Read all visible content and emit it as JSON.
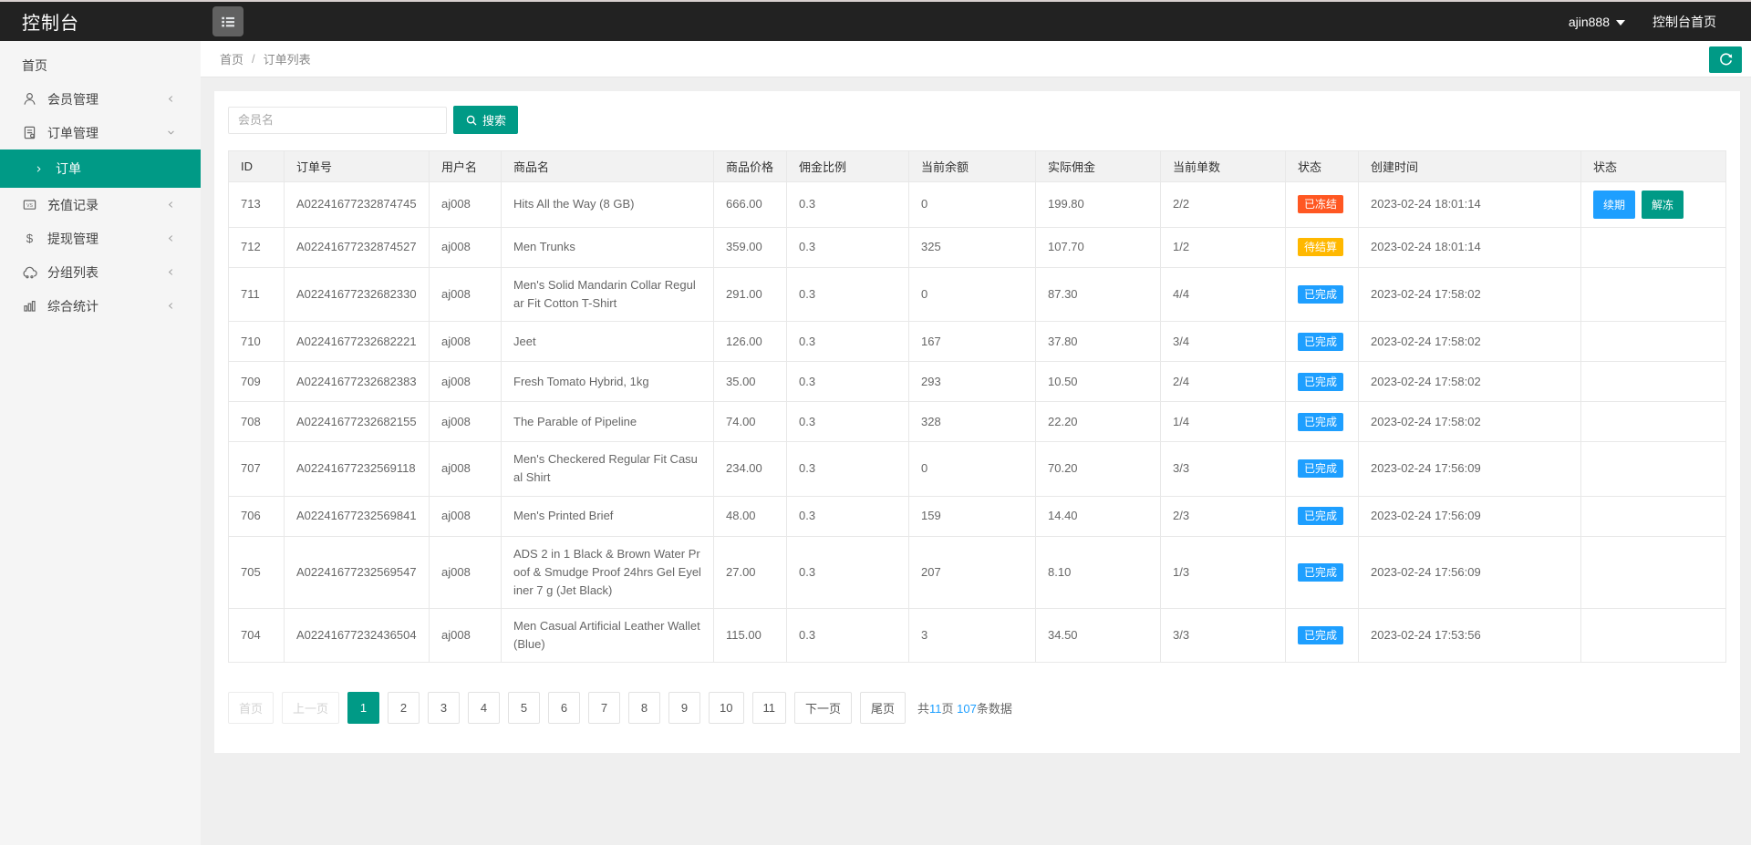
{
  "navbar": {
    "title": "控制台",
    "username": "ajin888",
    "console_home": "控制台首页"
  },
  "breadcrumb": {
    "home": "首页",
    "separator": "/",
    "current": "订单列表"
  },
  "search": {
    "placeholder": "会员名",
    "button_label": "搜索"
  },
  "sidebar": {
    "items": [
      {
        "key": "home",
        "label": "首页"
      },
      {
        "key": "members",
        "label": "会员管理",
        "icon": "user-icon",
        "chevron": "left"
      },
      {
        "key": "orders",
        "label": "订单管理",
        "icon": "order-icon",
        "chevron": "down",
        "submenu": [
          {
            "key": "order-list",
            "label": "订单",
            "active": true
          }
        ]
      },
      {
        "key": "recharge",
        "label": "充值记录",
        "icon": "card-icon",
        "chevron": "left"
      },
      {
        "key": "withdraw",
        "label": "提现管理",
        "icon": "dollar-icon",
        "chevron": "left"
      },
      {
        "key": "groups",
        "label": "分组列表",
        "icon": "group-icon",
        "chevron": "left"
      },
      {
        "key": "stats",
        "label": "综合统计",
        "icon": "chart-icon",
        "chevron": "left"
      }
    ]
  },
  "table": {
    "headers": [
      "ID",
      "订单号",
      "用户名",
      "商品名",
      "商品价格",
      "佣金比例",
      "当前余额",
      "实际佣金",
      "当前单数",
      "状态",
      "创建时间",
      "状态"
    ],
    "rows": [
      {
        "id": "713",
        "order_no": "A02241677232874745",
        "user": "aj008",
        "product": "Hits All the Way (8 GB)",
        "price": "666.00",
        "ratio": "0.3",
        "balance": "0",
        "commission": "199.80",
        "count": "2/2",
        "status": {
          "label": "已冻结",
          "type": "frozen"
        },
        "created": "2023-02-24 18:01:14",
        "actions": [
          {
            "label": "续期",
            "type": "renew"
          },
          {
            "label": "解冻",
            "type": "unfreeze"
          }
        ]
      },
      {
        "id": "712",
        "order_no": "A02241677232874527",
        "user": "aj008",
        "product": "Men Trunks",
        "price": "359.00",
        "ratio": "0.3",
        "balance": "325",
        "commission": "107.70",
        "count": "1/2",
        "status": {
          "label": "待结算",
          "type": "pending"
        },
        "created": "2023-02-24 18:01:14",
        "actions": []
      },
      {
        "id": "711",
        "order_no": "A02241677232682330",
        "user": "aj008",
        "product": "Men's Solid Mandarin Collar Regular Fit Cotton T-Shirt",
        "price": "291.00",
        "ratio": "0.3",
        "balance": "0",
        "commission": "87.30",
        "count": "4/4",
        "status": {
          "label": "已完成",
          "type": "done"
        },
        "created": "2023-02-24 17:58:02",
        "actions": []
      },
      {
        "id": "710",
        "order_no": "A02241677232682221",
        "user": "aj008",
        "product": "Jeet",
        "price": "126.00",
        "ratio": "0.3",
        "balance": "167",
        "commission": "37.80",
        "count": "3/4",
        "status": {
          "label": "已完成",
          "type": "done"
        },
        "created": "2023-02-24 17:58:02",
        "actions": []
      },
      {
        "id": "709",
        "order_no": "A02241677232682383",
        "user": "aj008",
        "product": "Fresh Tomato Hybrid, 1kg",
        "price": "35.00",
        "ratio": "0.3",
        "balance": "293",
        "commission": "10.50",
        "count": "2/4",
        "status": {
          "label": "已完成",
          "type": "done"
        },
        "created": "2023-02-24 17:58:02",
        "actions": []
      },
      {
        "id": "708",
        "order_no": "A02241677232682155",
        "user": "aj008",
        "product": "The Parable of Pipeline",
        "price": "74.00",
        "ratio": "0.3",
        "balance": "328",
        "commission": "22.20",
        "count": "1/4",
        "status": {
          "label": "已完成",
          "type": "done"
        },
        "created": "2023-02-24 17:58:02",
        "actions": []
      },
      {
        "id": "707",
        "order_no": "A02241677232569118",
        "user": "aj008",
        "product": "Men's Checkered Regular Fit Casual Shirt",
        "price": "234.00",
        "ratio": "0.3",
        "balance": "0",
        "commission": "70.20",
        "count": "3/3",
        "status": {
          "label": "已完成",
          "type": "done"
        },
        "created": "2023-02-24 17:56:09",
        "actions": []
      },
      {
        "id": "706",
        "order_no": "A02241677232569841",
        "user": "aj008",
        "product": "Men's Printed Brief",
        "price": "48.00",
        "ratio": "0.3",
        "balance": "159",
        "commission": "14.40",
        "count": "2/3",
        "status": {
          "label": "已完成",
          "type": "done"
        },
        "created": "2023-02-24 17:56:09",
        "actions": []
      },
      {
        "id": "705",
        "order_no": "A02241677232569547",
        "user": "aj008",
        "product": "ADS 2 in 1 Black & Brown Water Proof & Smudge Proof 24hrs Gel Eyeliner 7 g (Jet Black)",
        "price": "27.00",
        "ratio": "0.3",
        "balance": "207",
        "commission": "8.10",
        "count": "1/3",
        "status": {
          "label": "已完成",
          "type": "done"
        },
        "created": "2023-02-24 17:56:09",
        "actions": []
      },
      {
        "id": "704",
        "order_no": "A02241677232436504",
        "user": "aj008",
        "product": "Men Casual Artificial Leather Wallet (Blue)",
        "price": "115.00",
        "ratio": "0.3",
        "balance": "3",
        "commission": "34.50",
        "count": "3/3",
        "status": {
          "label": "已完成",
          "type": "done"
        },
        "created": "2023-02-24 17:53:56",
        "actions": []
      }
    ]
  },
  "pagination": {
    "first": "首页",
    "prev": "上一页",
    "pages": [
      "1",
      "2",
      "3",
      "4",
      "5",
      "6",
      "7",
      "8",
      "9",
      "10",
      "11"
    ],
    "active_page": "1",
    "next": "下一页",
    "last": "尾页",
    "summary": {
      "prefix": "共",
      "total_pages": "11",
      "pages_suffix": "页 ",
      "total_records": "107",
      "records_suffix": "条数据"
    }
  },
  "colors": {
    "accent": "#009a86",
    "blue": "#1e9fff",
    "frozen": "#ff5722",
    "pending": "#ffb800"
  }
}
